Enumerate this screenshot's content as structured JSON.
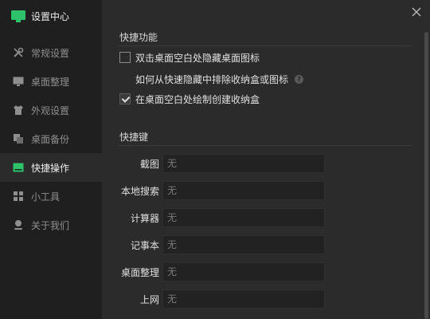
{
  "app": {
    "title": "设置中心"
  },
  "sidebar": {
    "items": [
      {
        "label": "常规设置",
        "icon": "wrench-icon"
      },
      {
        "label": "桌面整理",
        "icon": "monitor-icon"
      },
      {
        "label": "外观设置",
        "icon": "shirt-icon"
      },
      {
        "label": "桌面备份",
        "icon": "copy-icon"
      },
      {
        "label": "快捷操作",
        "icon": "screen-shortcut-icon",
        "active": true
      },
      {
        "label": "小工具",
        "icon": "grid-icon"
      },
      {
        "label": "关于我们",
        "icon": "person-icon"
      }
    ]
  },
  "shortcuts_section": {
    "title": "快捷功能",
    "option_hide_icons": {
      "label": "双击桌面空白处隐藏桌面图标",
      "checked": false
    },
    "link_exclude": {
      "label": "如何从快速隐藏中排除收纳盒或图标",
      "help": "?"
    },
    "option_draw_box": {
      "label": "在桌面空白处绘制创建收纳盒",
      "checked": true
    }
  },
  "hotkeys_section": {
    "title": "快捷键",
    "rows": [
      {
        "label": "截图",
        "value": "无"
      },
      {
        "label": "本地搜索",
        "value": "无"
      },
      {
        "label": "计算器",
        "value": "无"
      },
      {
        "label": "记事本",
        "value": "无"
      },
      {
        "label": "桌面整理",
        "value": "无"
      },
      {
        "label": "上网",
        "value": "无"
      }
    ]
  },
  "colors": {
    "accent": "#2ec36a",
    "sidebar_bg": "#1f1f1f",
    "content_bg": "#2b2b2b"
  }
}
